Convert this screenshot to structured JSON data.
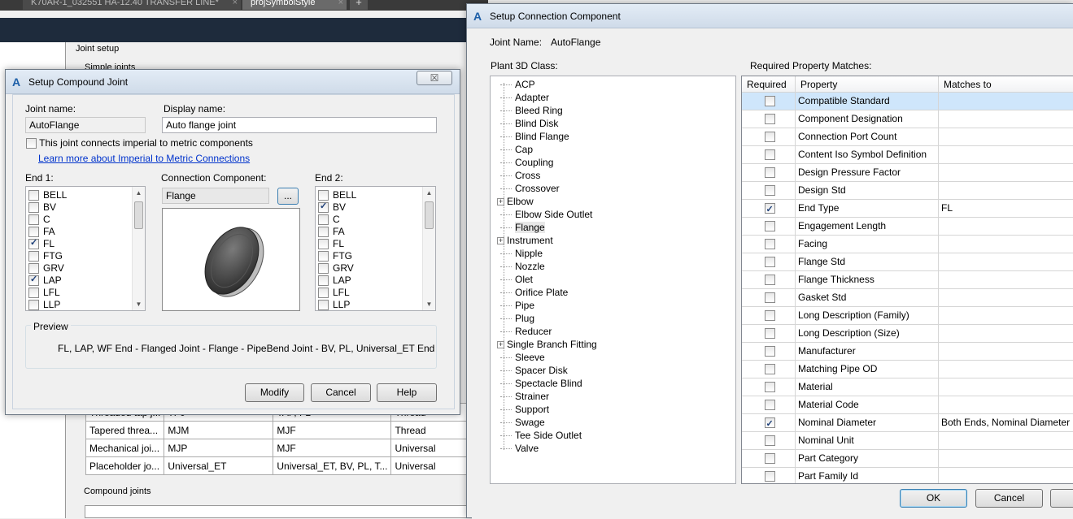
{
  "app_tabs": [
    {
      "label": "K70AR-1_032551 HA-12.40 TRANSFER LINE*",
      "close": "×"
    },
    {
      "label": "projSymbolStyle",
      "close": "×"
    }
  ],
  "new_tab": "+",
  "bg_panel": {
    "group_title": "Joint setup",
    "simple_joints_label": "Simple joints",
    "compound_joints_label": "Compound joints",
    "rows": [
      [
        "Threaded tap j...",
        "TPJ",
        "TAP, FL",
        "Thread"
      ],
      [
        "Tapered threa...",
        "MJM",
        "MJF",
        "Thread"
      ],
      [
        "Mechanical joi...",
        "MJP",
        "MJF",
        "Universal"
      ],
      [
        "Placeholder jo...",
        "Universal_ET",
        "Universal_ET, BV, PL, T...",
        "Universal"
      ]
    ]
  },
  "compound_dialog": {
    "title": "Setup Compound Joint",
    "close_glyph": "☒",
    "joint_name_label": "Joint name:",
    "joint_name_value": "AutoFlange",
    "display_name_label": "Display name:",
    "display_name_value": "Auto flange joint",
    "imperial_metric_label": "This joint connects imperial to metric components",
    "learn_more_link": "Learn more about Imperial to Metric Connections",
    "end1_label": "End 1:",
    "end1_items": [
      {
        "label": "BELL",
        "checked": false
      },
      {
        "label": "BV",
        "checked": false
      },
      {
        "label": "C",
        "checked": false
      },
      {
        "label": "FA",
        "checked": false
      },
      {
        "label": "FL",
        "checked": true
      },
      {
        "label": "FTG",
        "checked": false
      },
      {
        "label": "GRV",
        "checked": false
      },
      {
        "label": "LAP",
        "checked": true
      },
      {
        "label": "LFL",
        "checked": false
      },
      {
        "label": "LLP",
        "checked": false
      }
    ],
    "connection_component_label": "Connection Component:",
    "connection_component_value": "Flange",
    "browse_button": "...",
    "end2_label": "End 2:",
    "end2_items": [
      {
        "label": "BELL",
        "checked": false
      },
      {
        "label": "BV",
        "checked": true
      },
      {
        "label": "C",
        "checked": false
      },
      {
        "label": "FA",
        "checked": false
      },
      {
        "label": "FL",
        "checked": false
      },
      {
        "label": "FTG",
        "checked": false
      },
      {
        "label": "GRV",
        "checked": false
      },
      {
        "label": "LAP",
        "checked": false
      },
      {
        "label": "LFL",
        "checked": false
      },
      {
        "label": "LLP",
        "checked": false
      }
    ],
    "preview_label": "Preview",
    "preview_text": "FL, LAP, WF End - Flanged Joint - Flange - PipeBend Joint - BV, PL, Universal_ET End",
    "modify_button": "Modify",
    "cancel_button": "Cancel",
    "help_button": "Help"
  },
  "connection_dialog": {
    "title": "Setup Connection Component",
    "joint_name_label": "Joint Name:",
    "joint_name_value": "AutoFlange",
    "class_label": "Plant 3D Class:",
    "classes": [
      {
        "label": "ACP",
        "expandable": false
      },
      {
        "label": "Adapter",
        "expandable": false
      },
      {
        "label": "Bleed Ring",
        "expandable": false
      },
      {
        "label": "Blind Disk",
        "expandable": false
      },
      {
        "label": "Blind Flange",
        "expandable": false
      },
      {
        "label": "Cap",
        "expandable": false
      },
      {
        "label": "Coupling",
        "expandable": false
      },
      {
        "label": "Cross",
        "expandable": false
      },
      {
        "label": "Crossover",
        "expandable": false
      },
      {
        "label": "Elbow",
        "expandable": true
      },
      {
        "label": "Elbow Side Outlet",
        "expandable": false
      },
      {
        "label": "Flange",
        "expandable": false,
        "selected": true
      },
      {
        "label": "Instrument",
        "expandable": true
      },
      {
        "label": "Nipple",
        "expandable": false
      },
      {
        "label": "Nozzle",
        "expandable": false
      },
      {
        "label": "Olet",
        "expandable": false
      },
      {
        "label": "Orifice Plate",
        "expandable": false
      },
      {
        "label": "Pipe",
        "expandable": false
      },
      {
        "label": "Plug",
        "expandable": false
      },
      {
        "label": "Reducer",
        "expandable": false
      },
      {
        "label": "Single Branch Fitting",
        "expandable": true
      },
      {
        "label": "Sleeve",
        "expandable": false
      },
      {
        "label": "Spacer Disk",
        "expandable": false
      },
      {
        "label": "Spectacle Blind",
        "expandable": false
      },
      {
        "label": "Strainer",
        "expandable": false
      },
      {
        "label": "Support",
        "expandable": false
      },
      {
        "label": "Swage",
        "expandable": false
      },
      {
        "label": "Tee Side Outlet",
        "expandable": false
      },
      {
        "label": "Valve",
        "expandable": false
      }
    ],
    "matches_label": "Required Property Matches:",
    "columns": [
      "Required",
      "Property",
      "Matches to"
    ],
    "rows": [
      {
        "required": false,
        "property": "Compatible Standard",
        "matches": ""
      },
      {
        "required": false,
        "property": "Component Designation",
        "matches": ""
      },
      {
        "required": false,
        "property": "Connection Port Count",
        "matches": ""
      },
      {
        "required": false,
        "property": "Content Iso Symbol Definition",
        "matches": ""
      },
      {
        "required": false,
        "property": "Design Pressure Factor",
        "matches": ""
      },
      {
        "required": false,
        "property": "Design Std",
        "matches": ""
      },
      {
        "required": true,
        "property": "End Type",
        "matches": "FL"
      },
      {
        "required": false,
        "property": "Engagement Length",
        "matches": ""
      },
      {
        "required": false,
        "property": "Facing",
        "matches": ""
      },
      {
        "required": false,
        "property": "Flange Std",
        "matches": ""
      },
      {
        "required": false,
        "property": "Flange Thickness",
        "matches": ""
      },
      {
        "required": false,
        "property": "Gasket Std",
        "matches": ""
      },
      {
        "required": false,
        "property": "Long Description (Family)",
        "matches": ""
      },
      {
        "required": false,
        "property": "Long Description (Size)",
        "matches": ""
      },
      {
        "required": false,
        "property": "Manufacturer",
        "matches": ""
      },
      {
        "required": false,
        "property": "Matching Pipe OD",
        "matches": ""
      },
      {
        "required": false,
        "property": "Material",
        "matches": ""
      },
      {
        "required": false,
        "property": "Material Code",
        "matches": ""
      },
      {
        "required": true,
        "property": "Nominal Diameter",
        "matches": "Both Ends, Nominal Diameter"
      },
      {
        "required": false,
        "property": "Nominal Unit",
        "matches": ""
      },
      {
        "required": false,
        "property": "Part Category",
        "matches": ""
      },
      {
        "required": false,
        "property": "Part Family Id",
        "matches": ""
      }
    ],
    "ok_button": "OK",
    "cancel_button": "Cancel"
  }
}
